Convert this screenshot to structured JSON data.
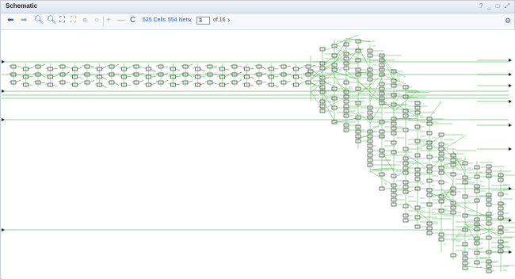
{
  "window": {
    "title": "Schematic",
    "controls": [
      "?",
      "_",
      "□",
      "⤢"
    ]
  },
  "toolbar": {
    "back_icon": "arrow-left-icon",
    "forward_icon": "arrow-right-icon",
    "cells_label": "525 Cells",
    "nets_label": "554 Nets",
    "page_value": "3",
    "page_of_label": "of 16"
  },
  "settings_icon": "gear-icon",
  "colors": {
    "wire": "#2ea82e",
    "component": "#1a1a1a",
    "link": "#2b5fa8"
  }
}
